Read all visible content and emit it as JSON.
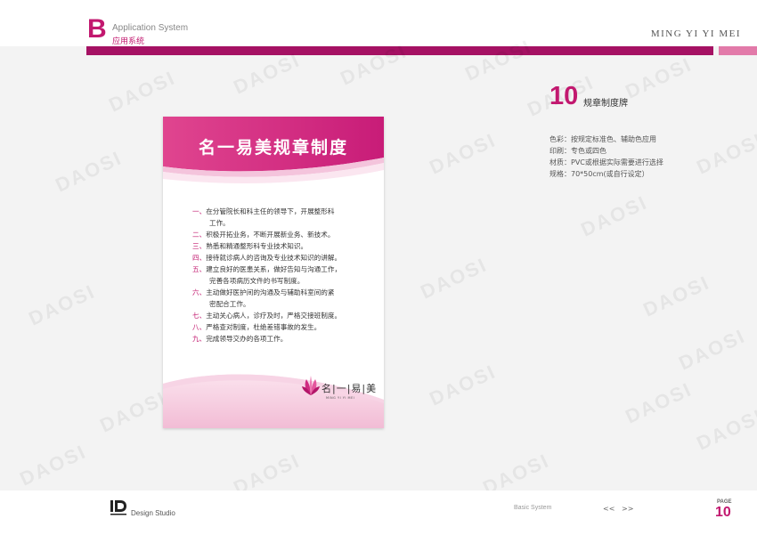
{
  "header": {
    "section_letter": "B",
    "title_en": "Application System",
    "title_zh": "应用系统",
    "brand_right": "MING YI YI MEI",
    "accent_color": "#c2186f",
    "bar_color": "#a51163",
    "bar_side_color": "#e27aa9"
  },
  "watermark": {
    "text": "DAOSI"
  },
  "board": {
    "title": "名一易美规章制度",
    "rules": [
      {
        "num": "一、",
        "lines": [
          "在分管院长和科主任的领导下，开展整形科",
          "工作。"
        ]
      },
      {
        "num": "二、",
        "lines": [
          "积极开拓业务，不断开展新业务、新技术。"
        ]
      },
      {
        "num": "三、",
        "lines": [
          "熟悉和精通整形科专业技术知识。"
        ]
      },
      {
        "num": "四、",
        "lines": [
          "接待就诊病人的咨询及专业技术知识的讲解。"
        ]
      },
      {
        "num": "五、",
        "lines": [
          "建立良好的医患关系，做好告知与沟通工作，",
          "完善各项病历文件的书写制度。"
        ]
      },
      {
        "num": "六、",
        "lines": [
          "主动做好医护间的沟通及与辅助科室间的紧",
          "密配合工作。"
        ]
      },
      {
        "num": "七、",
        "lines": [
          "主动关心病人，诊疗及时，严格交接班制度。"
        ]
      },
      {
        "num": "八、",
        "lines": [
          "严格查对制度，杜绝差错事故的发生。"
        ]
      },
      {
        "num": "九、",
        "lines": [
          "完成领导交办的各项工作。"
        ]
      }
    ],
    "logo_name": "名|一|易|美",
    "logo_sub": "MING YI YI MEI"
  },
  "info": {
    "number": "10",
    "label": "规章制度牌",
    "specs": [
      "色彩：按规定标准色、辅助色应用",
      "印刷：专色或四色",
      "材质：PVC或根据实际需要进行选择",
      "规格：70*50cm(或自行设定）"
    ]
  },
  "footer": {
    "studio": "Design Studio",
    "basic_system": "Basic System",
    "prev": "<<",
    "next": ">>",
    "page_label": "PAGE",
    "page_number": "10"
  }
}
